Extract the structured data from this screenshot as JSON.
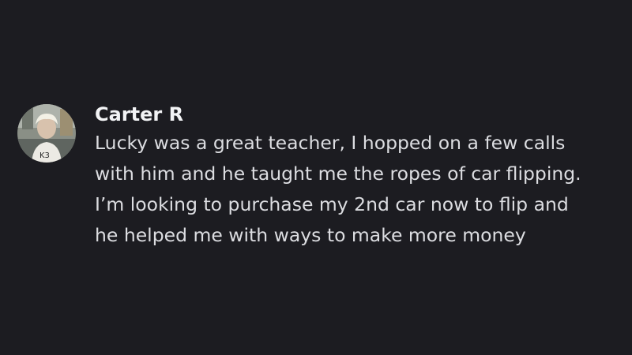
{
  "message": {
    "author": "Carter R",
    "avatar_icon": "user-avatar-photo",
    "lines": [
      "Lucky was a great teacher, I hopped on a few calls",
      "with him and he taught me the ropes of car flipping.",
      "I’m looking to purchase my 2nd car now to flip and",
      "he helped me with ways to make more money"
    ]
  },
  "colors": {
    "background": "#1c1c21",
    "author": "#f2f3f5",
    "text": "#dcdde1"
  }
}
